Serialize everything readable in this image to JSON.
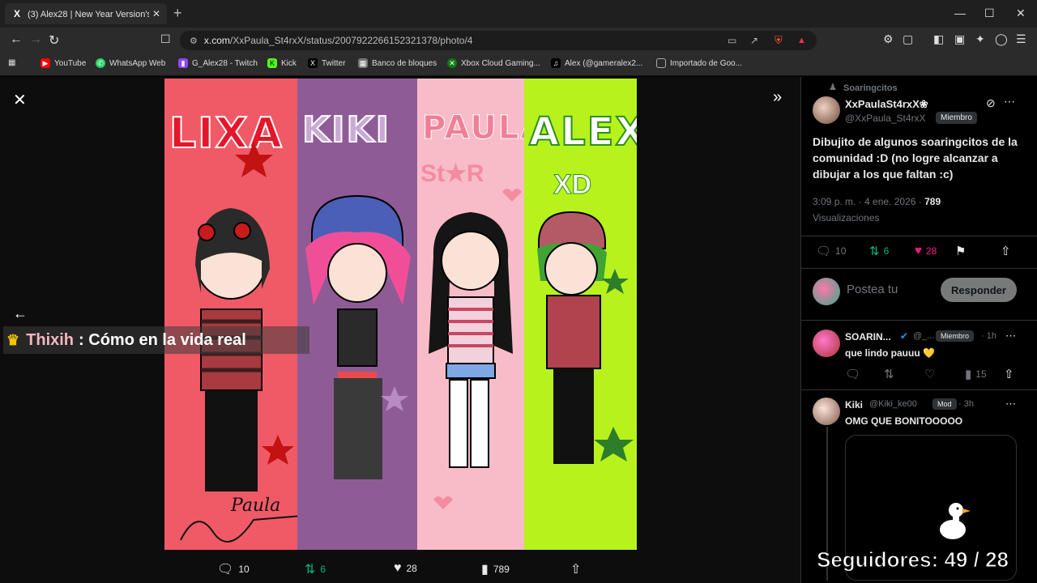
{
  "browser": {
    "tab_title": "(3) Alex28 | New Year Version's ★",
    "tab_favicon": "X",
    "tab_close": "✕",
    "new_tab": "+",
    "url_host": "x.com",
    "url_path": "/XxPaula_St4rxX/status/2007922266152321378/photo/4",
    "window_controls": [
      "—",
      "☐",
      "✕"
    ]
  },
  "bookmarks": [
    {
      "label": "YouTube",
      "icon": "youtube-icon",
      "color": "#ff0000"
    },
    {
      "label": "WhatsApp Web",
      "icon": "whatsapp-icon",
      "color": "#25d366"
    },
    {
      "label": "G_Alex28 - Twitch",
      "icon": "twitch-icon",
      "color": "#9146ff"
    },
    {
      "label": "Kick",
      "icon": "kick-icon",
      "color": "#53fc18"
    },
    {
      "label": "Twitter",
      "icon": "x-icon",
      "color": "#000000"
    },
    {
      "label": "Banco de bloques",
      "icon": "block-icon",
      "color": "#777777"
    },
    {
      "label": "Xbox Cloud Gaming...",
      "icon": "xbox-icon",
      "color": "#107c10"
    },
    {
      "label": "Alex (@gameralex2...",
      "icon": "tiktok-icon",
      "color": "#000000"
    },
    {
      "label": "Importado de Goo...",
      "icon": "folder-icon",
      "color": "#aaaaaa"
    }
  ],
  "artwork": {
    "names": [
      "LIXA",
      "KIKI",
      "PAULA",
      "ALEX"
    ],
    "subs": [
      "",
      "",
      "St★R",
      "XD"
    ],
    "signature": "Paula",
    "panel_colors": [
      "#f05a66",
      "#8f5b96",
      "#f8bcc8",
      "#b7f21d"
    ]
  },
  "overlay": {
    "user": "Thixih",
    "message": ": Cómo en la vida real"
  },
  "photo_actions": {
    "replies": "10",
    "reposts": "6",
    "likes": "28",
    "views": "789"
  },
  "post": {
    "community": "Soaringcitos",
    "author": "XxPaulaSt4rxX❀",
    "handle": "@XxPaula_St4rxX",
    "badge": "Miembro",
    "text": "Dibujito de algunos soaringcitos de la comunidad :D (no logre alcanzar a dibujar a los que faltan :c)",
    "time": "3:09 p. m. · 4 ene. 2026 · ",
    "views_count": "789",
    "views_label": "Visualizaciones",
    "replies": "10",
    "reposts": "6",
    "likes": "28"
  },
  "reply_box": {
    "placeholder": "Postea tu",
    "button": "Responder"
  },
  "replies": [
    {
      "name": "SOARIN...",
      "handle": "@_...",
      "badge": "Miembro",
      "time": "· 1h",
      "text": "que lindo pauuu 💛",
      "views": "15"
    },
    {
      "name": "Kiki",
      "handle": "@Kiki_ke00",
      "badge": "Mod",
      "time": "· 3h",
      "text": "OMG QUE BONITOOOOO"
    }
  ],
  "stream": {
    "followers": "Seguidores: 49 / 28"
  }
}
